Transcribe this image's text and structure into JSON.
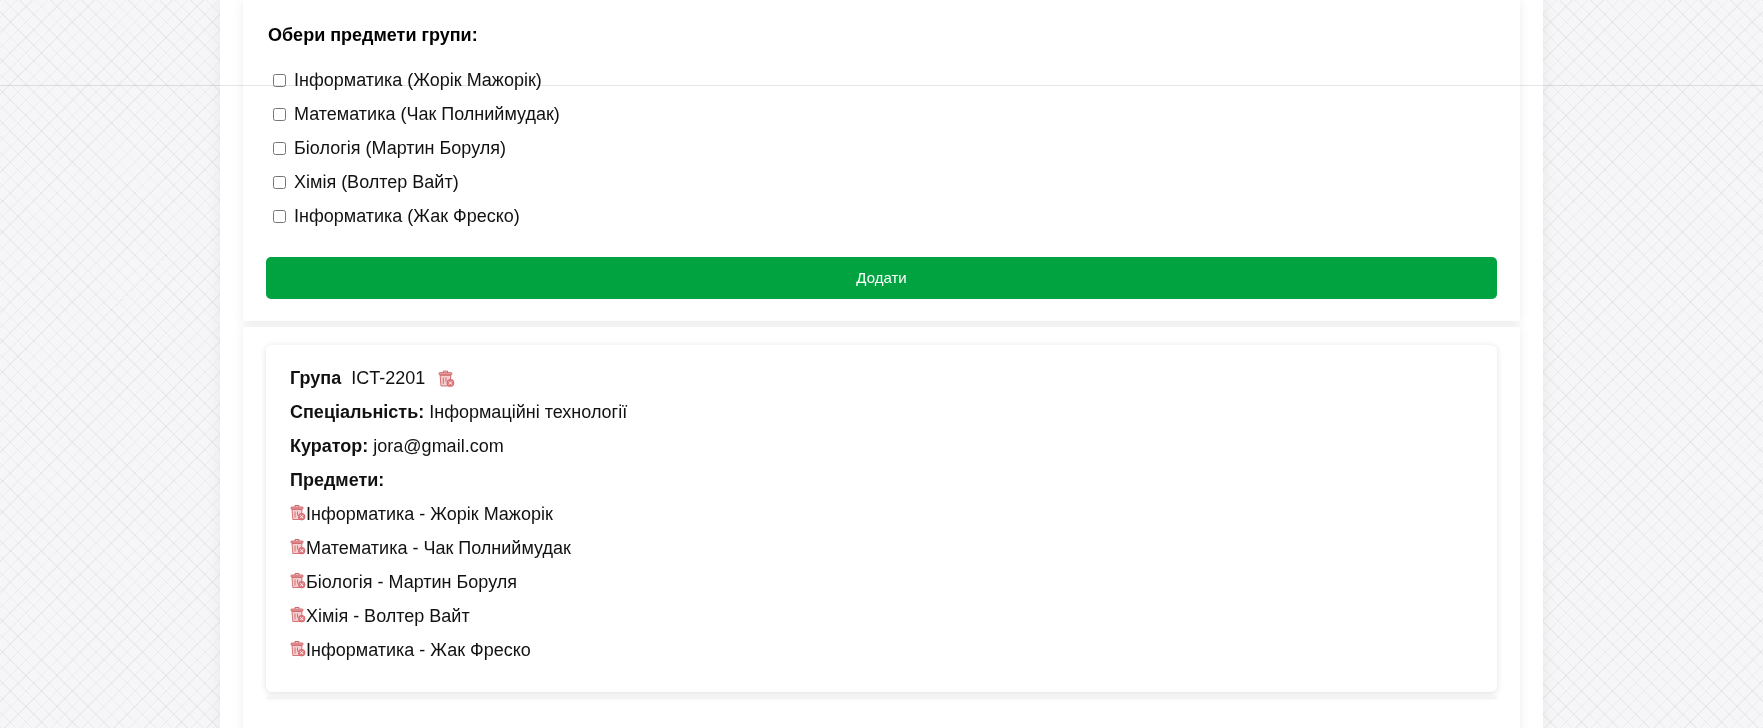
{
  "subject_picker": {
    "title": "Обери предмети групи:",
    "options": [
      {
        "label": "Інформатика (Жорік Мажорік)",
        "checked": false
      },
      {
        "label": "Математика (Чак Полниймудак)",
        "checked": false
      },
      {
        "label": "Біологія (Мартин Боруля)",
        "checked": false
      },
      {
        "label": "Хімія (Волтер Вайт)",
        "checked": false
      },
      {
        "label": "Інформатика (Жак Фреско)",
        "checked": false
      }
    ]
  },
  "add_button": {
    "label": "Додати"
  },
  "groups": [
    {
      "label": "Група",
      "name": "ICT-2201",
      "fields": [
        {
          "label": "Спеціальність:",
          "value": "Інформаційні технології"
        },
        {
          "label": "Куратор:",
          "value": "jora@gmail.com"
        }
      ],
      "subjects_heading": "Предмети:",
      "subjects": [
        "Інформатика - Жорік Мажорік",
        "Математика - Чак Полниймудак",
        "Біологія - Мартин Боруля",
        "Хімія - Волтер Вайт",
        "Інформатика - Жак Фреско"
      ]
    }
  ]
}
